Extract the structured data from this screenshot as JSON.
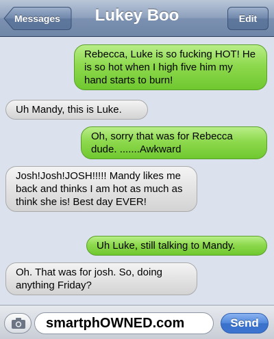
{
  "header": {
    "back_label": "Messages",
    "title": "Lukey Boo",
    "edit_label": "Edit"
  },
  "messages": [
    {
      "direction": "sent",
      "text": "Rebecca, Luke is so fucking HOT! He is so hot when I high five him my hand starts to burn!"
    },
    {
      "direction": "received",
      "text": "Uh Mandy, this is Luke."
    },
    {
      "direction": "sent",
      "text": "Oh, sorry that was for Rebecca dude. .......Awkward"
    },
    {
      "direction": "received",
      "text": "Josh!Josh!JOSH!!!!! Mandy likes me back and thinks I am hot as much as think she is! Best day EVER!"
    },
    {
      "direction": "sent",
      "text": "Uh Luke, still talking to Mandy."
    },
    {
      "direction": "received",
      "text": "Oh. That was for josh. So, doing anything Friday?"
    }
  ],
  "composer": {
    "field_text": "smartphOWNED.com",
    "send_label": "Send",
    "camera_icon": "camera-icon"
  },
  "colors": {
    "sent_bubble": "#8ed94e",
    "received_bubble": "#e0e0e0",
    "send_button": "#4f86dc",
    "background": "#dbe2ed"
  }
}
